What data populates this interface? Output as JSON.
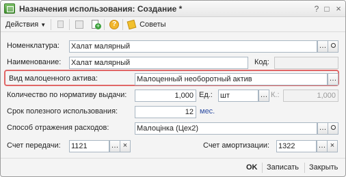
{
  "window": {
    "title": "Назначения использования: Создание *"
  },
  "toolbar": {
    "actions_label": "Действия",
    "tips_label": "Советы"
  },
  "form": {
    "nomenclature": {
      "label": "Номенклатура:",
      "value": "Халат малярный"
    },
    "name": {
      "label": "Наименование:",
      "value": "Халат малярный"
    },
    "code": {
      "label": "Код:",
      "value": ""
    },
    "asset_type": {
      "label": "Вид малоценного актива:",
      "value": "Малоценный необоротный актив"
    },
    "norm_qty": {
      "label": "Количество по нормативу выдачи:",
      "value": "1,000"
    },
    "unit": {
      "label": "Ед.:",
      "value": "шт"
    },
    "k": {
      "label": "К.:",
      "value": "1,000"
    },
    "useful_life": {
      "label": "Срок полезного использования:",
      "value": "12",
      "unit": "мес."
    },
    "expense_method": {
      "label": "Способ отражения расходов:",
      "value": "Малоцінка (Цех2)"
    },
    "transfer_account": {
      "label": "Счет передачи:",
      "value": "1121"
    },
    "amortization_account": {
      "label": "Счет амортизации:",
      "value": "1322"
    }
  },
  "footer": {
    "ok_label": "OK",
    "save_label": "Записать",
    "close_label": "Закрыть"
  },
  "colors": {
    "highlight": "#e06666",
    "link": "#2a4aa0"
  }
}
